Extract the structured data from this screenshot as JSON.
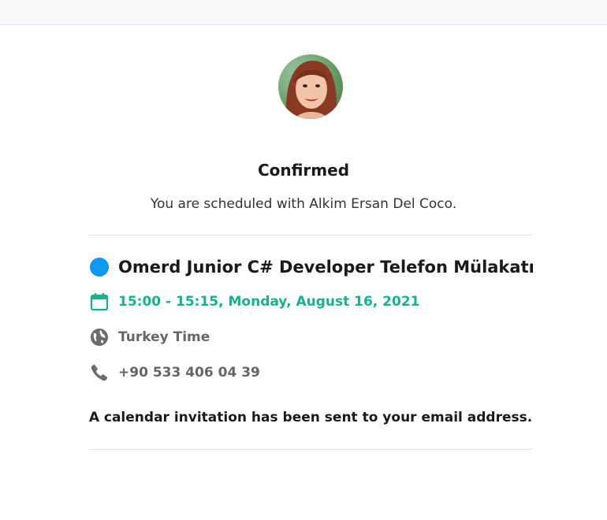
{
  "header": {
    "status": "Confirmed",
    "subtitle": "You are scheduled with Alkim Ersan Del Coco."
  },
  "host": {
    "avatar_icon": "host-avatar",
    "name": "Alkim Ersan Del Coco"
  },
  "event": {
    "name": "Omerd Junior C# Developer Telefon Mülakatı",
    "color": "#0d99f2",
    "datetime": "15:00 - 15:15, Monday, August 16, 2021",
    "datetime_color": "#14b38a",
    "timezone": "Turkey Time",
    "phone": "+90 533 406 04 39"
  },
  "notice": "A calendar invitation has been sent to your email address."
}
